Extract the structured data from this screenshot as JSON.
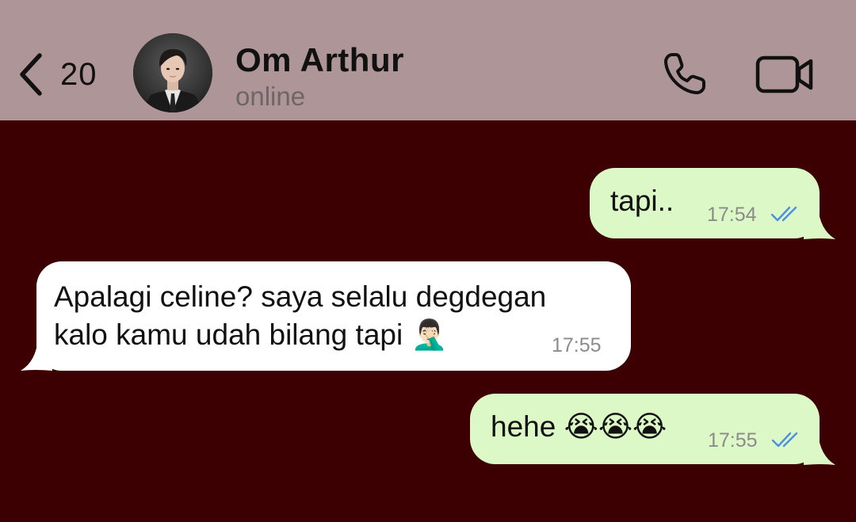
{
  "header": {
    "back_count": "20",
    "contact_name": "Om Arthur",
    "status": "online",
    "icons": {
      "back": "chevron-left-icon",
      "call": "phone-icon",
      "video": "video-camera-icon"
    }
  },
  "colors": {
    "header_bg": "#ae9597",
    "chat_bg": "#3d0002",
    "outgoing_bubble": "#dcf8c6",
    "incoming_bubble": "#ffffff",
    "read_ticks": "#4a90e2"
  },
  "messages": [
    {
      "direction": "outgoing",
      "text": "tapi..",
      "time": "17:54",
      "status": "read"
    },
    {
      "direction": "incoming",
      "lines": [
        "Apalagi celine? saya selalu degdegan",
        "kalo kamu udah bilang tapi 🤦🏻‍♂️"
      ],
      "time": "17:55"
    },
    {
      "direction": "outgoing",
      "text": "hehe 😭😭😭",
      "time": "17:55",
      "status": "read"
    }
  ]
}
